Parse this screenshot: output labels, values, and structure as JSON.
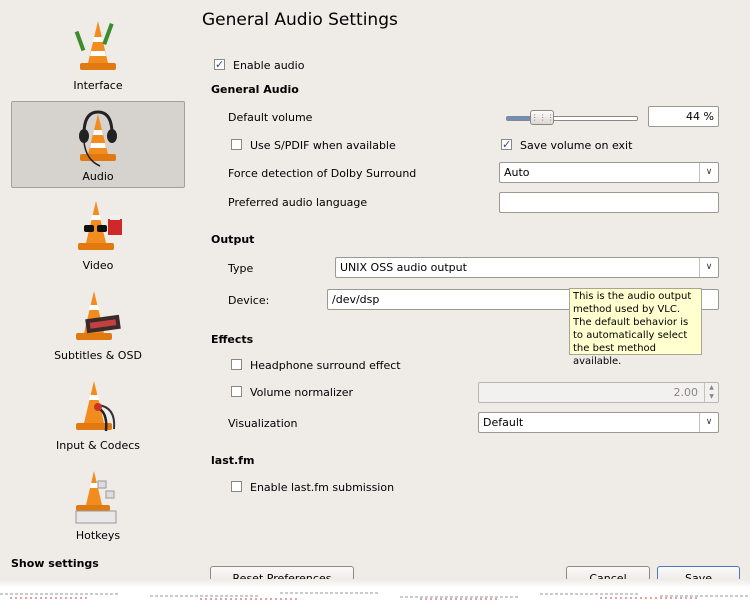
{
  "sidebar": {
    "items": [
      {
        "label": "Interface",
        "icon": "vlc-cone-brush-icon"
      },
      {
        "label": "Audio",
        "icon": "vlc-cone-headphones-icon"
      },
      {
        "label": "Video",
        "icon": "vlc-cone-glasses-icon"
      },
      {
        "label": "Subtitles & OSD",
        "icon": "vlc-cone-subtitle-icon"
      },
      {
        "label": "Input & Codecs",
        "icon": "vlc-cone-cables-icon"
      },
      {
        "label": "Hotkeys",
        "icon": "vlc-cone-keyboard-icon"
      }
    ],
    "selected": "Audio",
    "show_settings": "Show settings"
  },
  "page": {
    "title": "General Audio Settings"
  },
  "enable_audio": {
    "label": "Enable audio",
    "checked": true
  },
  "general_audio": {
    "header": "General Audio",
    "default_volume_label": "Default volume",
    "volume_value": "44 %",
    "volume_fraction": 0.22,
    "spdif_label": "Use S/PDIF when available",
    "save_volume_label": "Save volume on exit",
    "dolby_label": "Force detection of Dolby Surround",
    "dolby_value": "Auto",
    "pref_lang_label": "Preferred audio language",
    "pref_lang_value": ""
  },
  "output": {
    "header": "Output",
    "type_label": "Type",
    "type_value": "UNIX OSS audio output",
    "device_label": "Device:",
    "device_value": "/dev/dsp"
  },
  "tooltip": {
    "text": "This is the audio output method used by VLC. The default behavior is to automatically select the best method available."
  },
  "effects": {
    "header": "Effects",
    "headphone_label": "Headphone surround effect",
    "normalizer_label": "Volume normalizer",
    "normalizer_value": "2.00",
    "visualization_label": "Visualization",
    "visualization_value": "Default"
  },
  "lastfm": {
    "header": "last.fm",
    "enable_label": "Enable last.fm submission"
  },
  "buttons": {
    "reset": "Reset Preferences",
    "cancel": "Cancel",
    "save": "Save"
  },
  "colors": {
    "cone_orange": "#f28c1e",
    "accent": "#4f78b8",
    "tooltip_bg": "#ffffcf"
  }
}
